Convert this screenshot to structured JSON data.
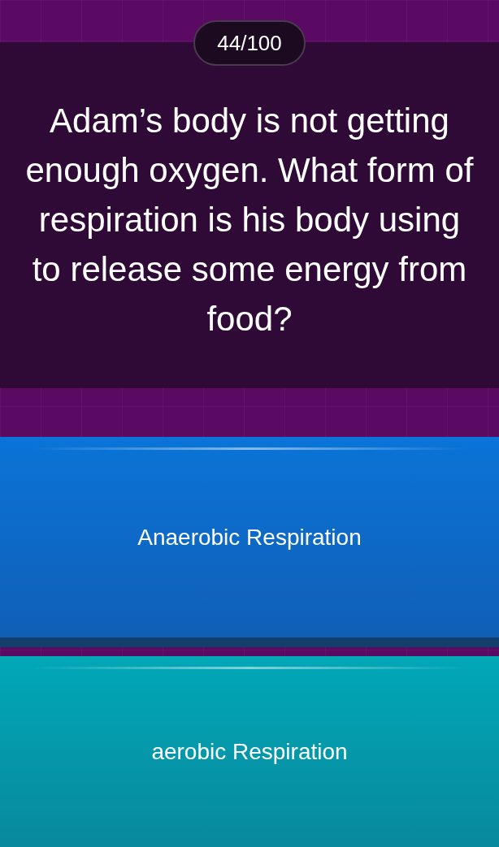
{
  "counter": "44/100",
  "question": "Adam’s body is not getting enough oxygen. What form of respiration is his body using to release some energy from food?",
  "answers": [
    {
      "text": "Anaerobic Respiration",
      "color": "#0a74d8"
    },
    {
      "text": "aerobic Respiration",
      "color": "#00a8b8"
    }
  ]
}
